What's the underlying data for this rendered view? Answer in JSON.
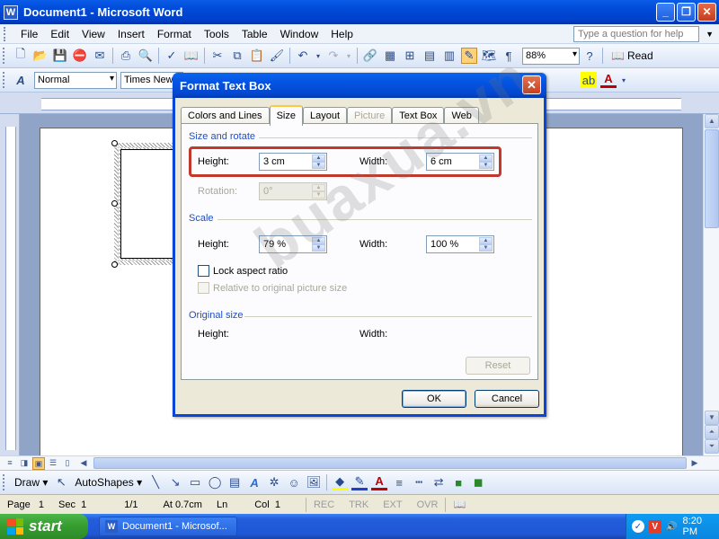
{
  "window": {
    "title": "Document1 - Microsoft Word",
    "app_icon": "W"
  },
  "menu": {
    "items": [
      "File",
      "Edit",
      "View",
      "Insert",
      "Format",
      "Tools",
      "Table",
      "Window",
      "Help"
    ],
    "help_placeholder": "Type a question for help"
  },
  "standard_toolbar": {
    "zoom": "88%",
    "read_label": "Read"
  },
  "formatting_toolbar": {
    "style": "Normal",
    "font": "Times New Ro"
  },
  "dialog": {
    "title": "Format Text Box",
    "tabs": [
      {
        "label": "Colors and Lines",
        "state": "normal"
      },
      {
        "label": "Size",
        "state": "active"
      },
      {
        "label": "Layout",
        "state": "normal"
      },
      {
        "label": "Picture",
        "state": "disabled"
      },
      {
        "label": "Text Box",
        "state": "normal"
      },
      {
        "label": "Web",
        "state": "normal"
      }
    ],
    "size_rotate": {
      "header": "Size and rotate",
      "height_label": "Height:",
      "height_value": "3 cm",
      "width_label": "Width:",
      "width_value": "6 cm",
      "rotation_label": "Rotation:",
      "rotation_value": "0°"
    },
    "scale": {
      "header": "Scale",
      "height_label": "Height:",
      "height_value": "79 %",
      "width_label": "Width:",
      "width_value": "100 %",
      "lock_aspect": "Lock aspect ratio",
      "relative_original": "Relative to original picture size"
    },
    "original_size": {
      "header": "Original size",
      "height_label": "Height:",
      "width_label": "Width:"
    },
    "reset_label": "Reset",
    "ok_label": "OK",
    "cancel_label": "Cancel"
  },
  "draw_toolbar": {
    "draw_label": "Draw",
    "autoshapes_label": "AutoShapes"
  },
  "status": {
    "page": "Page",
    "page_num": "1",
    "sec": "Sec",
    "sec_num": "1",
    "page_of": "1/1",
    "at": "At",
    "at_value": "0.7cm",
    "ln": "Ln",
    "col": "Col",
    "col_num": "1",
    "rec": "REC",
    "trk": "TRK",
    "ext": "EXT",
    "ovr": "OVR"
  },
  "taskbar": {
    "start_label": "start",
    "task_label": "Document1 - Microsof...",
    "clock": "8:20 PM"
  },
  "watermark": "buaxua.vn",
  "colors": {
    "xp_blue": "#0A5DE8",
    "highlight_red": "#C0392B",
    "section_blue": "#1E4FC4"
  }
}
